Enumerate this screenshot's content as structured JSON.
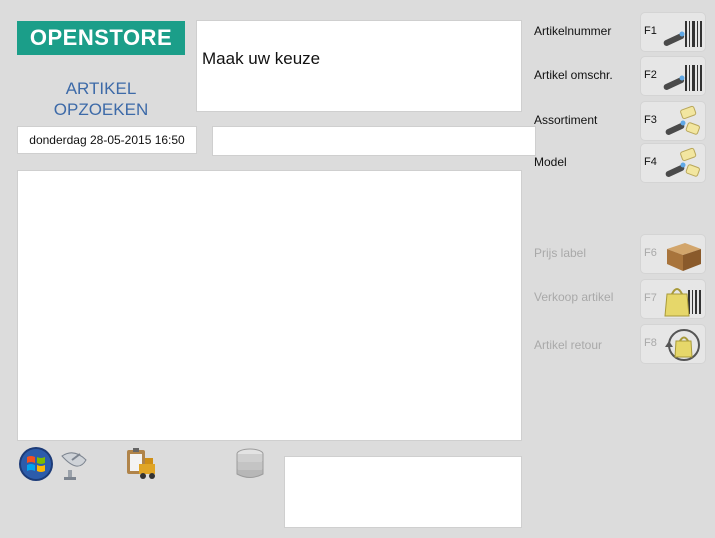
{
  "app": {
    "logo_text": "OPENSTORE",
    "title_line1": "ARTIKEL",
    "title_line2": "OPZOEKEN",
    "message": "Maak uw keuze",
    "datetime": "donderdag 28-05-2015 16:50",
    "search_value": ""
  },
  "functions": [
    {
      "label": "Artikelnummer",
      "key": "F1",
      "icon": "barcode-scanner-icon",
      "enabled": true
    },
    {
      "label": "Artikel omschr.",
      "key": "F2",
      "icon": "barcode-scanner-icon",
      "enabled": true
    },
    {
      "label": "Assortiment",
      "key": "F3",
      "icon": "scanner-tags-icon",
      "enabled": true
    },
    {
      "label": "Model",
      "key": "F4",
      "icon": "scanner-tags-icon",
      "enabled": true
    },
    {
      "label": "Prijs label",
      "key": "F6",
      "icon": "box-icon",
      "enabled": false
    },
    {
      "label": "Verkoop artikel",
      "key": "F7",
      "icon": "bag-barcode-icon",
      "enabled": false
    },
    {
      "label": "Artikel retour",
      "key": "F8",
      "icon": "bag-return-icon",
      "enabled": false
    }
  ],
  "colors": {
    "brand": "#1b9e89",
    "title": "#3d6aa8",
    "disabled_text": "#a9a9a9"
  },
  "tray_icons": [
    "windows-icon",
    "satellite-dish-icon",
    "clipboard-forklift-icon",
    "database-icon"
  ]
}
